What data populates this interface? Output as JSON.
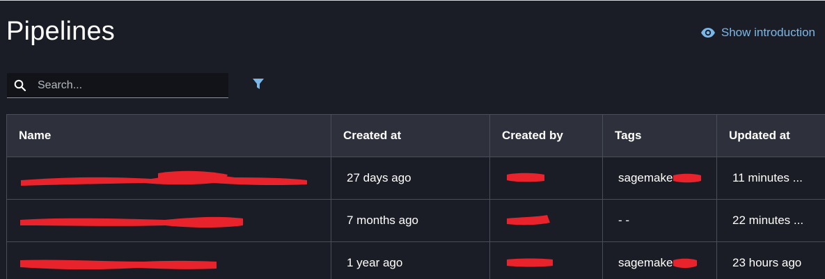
{
  "header": {
    "title": "Pipelines",
    "intro_link": "Show introduction"
  },
  "search": {
    "placeholder": "Search..."
  },
  "table": {
    "columns": [
      "Name",
      "Created at",
      "Created by",
      "Tags",
      "Updated at"
    ],
    "rows": [
      {
        "created_at": "27 days ago",
        "tags": "sagemake",
        "updated_at": "11 minutes ..."
      },
      {
        "created_at": "7 months ago",
        "tags": "- -",
        "updated_at": "22 minutes ..."
      },
      {
        "created_at": "1 year ago",
        "tags": "sagemake",
        "updated_at": "23 hours ago"
      }
    ]
  },
  "colors": {
    "background": "#1b1d26",
    "header_bg": "#2e313b",
    "link": "#7ab8e9",
    "redaction": "#e8232b"
  },
  "icons": {
    "intro": "eye-icon",
    "search": "search-icon",
    "filter": "filter-icon"
  }
}
